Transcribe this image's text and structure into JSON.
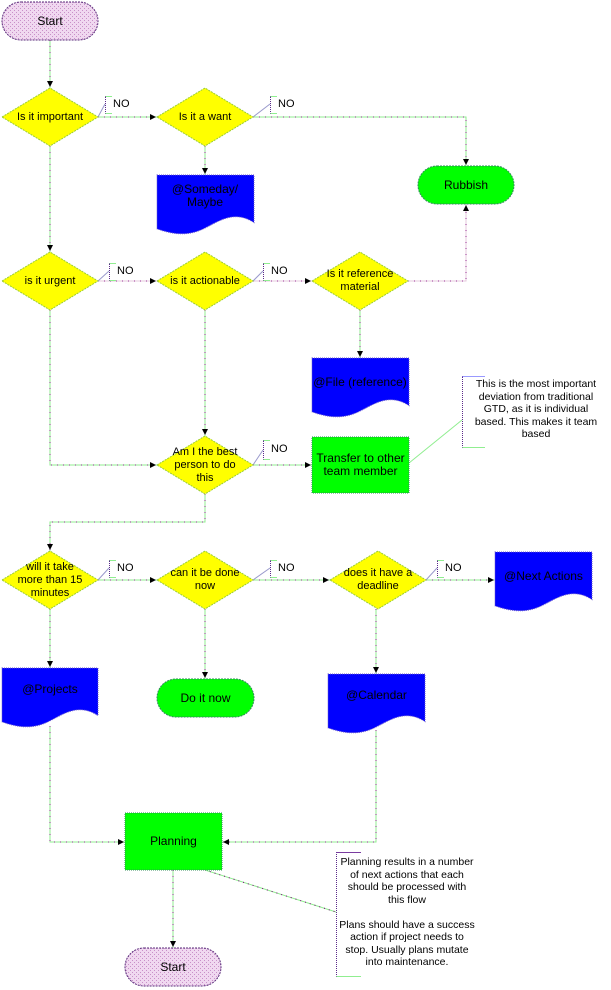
{
  "diagram": {
    "type": "flowchart",
    "colors": {
      "decision": "#ffff00",
      "process": "#00ff00",
      "terminal_green": "#00ff00",
      "document": "#0000ff",
      "start_terminal": "#e8c8e8",
      "connector": "#90ee90",
      "connector_dots": "#800080",
      "arrow": "#000000"
    },
    "nodes": {
      "start": {
        "label": "Start",
        "shape": "terminal"
      },
      "is_important": {
        "label": "Is it important",
        "shape": "decision"
      },
      "is_want": {
        "label": "Is it a want",
        "shape": "decision"
      },
      "someday_maybe": {
        "label": "@Someday/\nMaybe",
        "shape": "document"
      },
      "rubbish": {
        "label": "Rubbish",
        "shape": "terminal"
      },
      "is_urgent": {
        "label": "is it urgent",
        "shape": "decision"
      },
      "is_actionable": {
        "label": "is it actionable",
        "shape": "decision"
      },
      "is_reference": {
        "label": "Is it reference\nmaterial",
        "shape": "decision"
      },
      "file_reference": {
        "label": "@File (reference)",
        "shape": "document"
      },
      "best_person": {
        "label": "Am I the best\nperson to do\nthis",
        "shape": "decision"
      },
      "transfer": {
        "label": "Transfer to other\nteam member",
        "shape": "process"
      },
      "more_than_15": {
        "label": "will it take\nmore than 15\nminutes",
        "shape": "decision"
      },
      "done_now": {
        "label": "can it be done\nnow",
        "shape": "decision"
      },
      "has_deadline": {
        "label": "does it have a\ndeadline",
        "shape": "decision"
      },
      "next_actions": {
        "label": "@Next Actions",
        "shape": "document"
      },
      "projects": {
        "label": "@Projects",
        "shape": "document"
      },
      "do_it_now": {
        "label": "Do it now",
        "shape": "terminal"
      },
      "calendar": {
        "label": "@Calendar",
        "shape": "document"
      },
      "planning": {
        "label": "Planning",
        "shape": "process"
      },
      "end_start": {
        "label": "Start",
        "shape": "terminal"
      }
    },
    "no_label": "NO",
    "notes": {
      "transfer_note": "This is the most important\ndeviation from traditional\nGTD, as it is individual\nbased. This makes it team\nbased",
      "planning_note": "Planning results in a number\nof next actions that each\nshould be processed with\nthis flow\n\nPlans should have a success\naction if project needs to\nstop. Usually plans mutate\ninto maintenance."
    },
    "edges": [
      {
        "from": "start",
        "to": "is_important",
        "label": ""
      },
      {
        "from": "is_important",
        "to": "is_want",
        "label": "NO"
      },
      {
        "from": "is_want",
        "to": "rubbish",
        "label": "NO"
      },
      {
        "from": "is_want",
        "to": "someday_maybe",
        "label": ""
      },
      {
        "from": "is_important",
        "to": "is_urgent",
        "label": ""
      },
      {
        "from": "is_urgent",
        "to": "is_actionable",
        "label": "NO"
      },
      {
        "from": "is_actionable",
        "to": "is_reference",
        "label": "NO"
      },
      {
        "from": "is_reference",
        "to": "rubbish",
        "label": ""
      },
      {
        "from": "is_reference",
        "to": "file_reference",
        "label": ""
      },
      {
        "from": "is_actionable",
        "to": "best_person",
        "label": ""
      },
      {
        "from": "is_urgent",
        "to": "best_person",
        "label": ""
      },
      {
        "from": "best_person",
        "to": "transfer",
        "label": "NO"
      },
      {
        "from": "best_person",
        "to": "more_than_15",
        "label": ""
      },
      {
        "from": "more_than_15",
        "to": "done_now",
        "label": "NO"
      },
      {
        "from": "done_now",
        "to": "has_deadline",
        "label": "NO"
      },
      {
        "from": "has_deadline",
        "to": "next_actions",
        "label": "NO"
      },
      {
        "from": "more_than_15",
        "to": "projects",
        "label": ""
      },
      {
        "from": "done_now",
        "to": "do_it_now",
        "label": ""
      },
      {
        "from": "has_deadline",
        "to": "calendar",
        "label": ""
      },
      {
        "from": "projects",
        "to": "planning",
        "label": ""
      },
      {
        "from": "calendar",
        "to": "planning",
        "label": ""
      },
      {
        "from": "planning",
        "to": "end_start",
        "label": ""
      }
    ]
  }
}
